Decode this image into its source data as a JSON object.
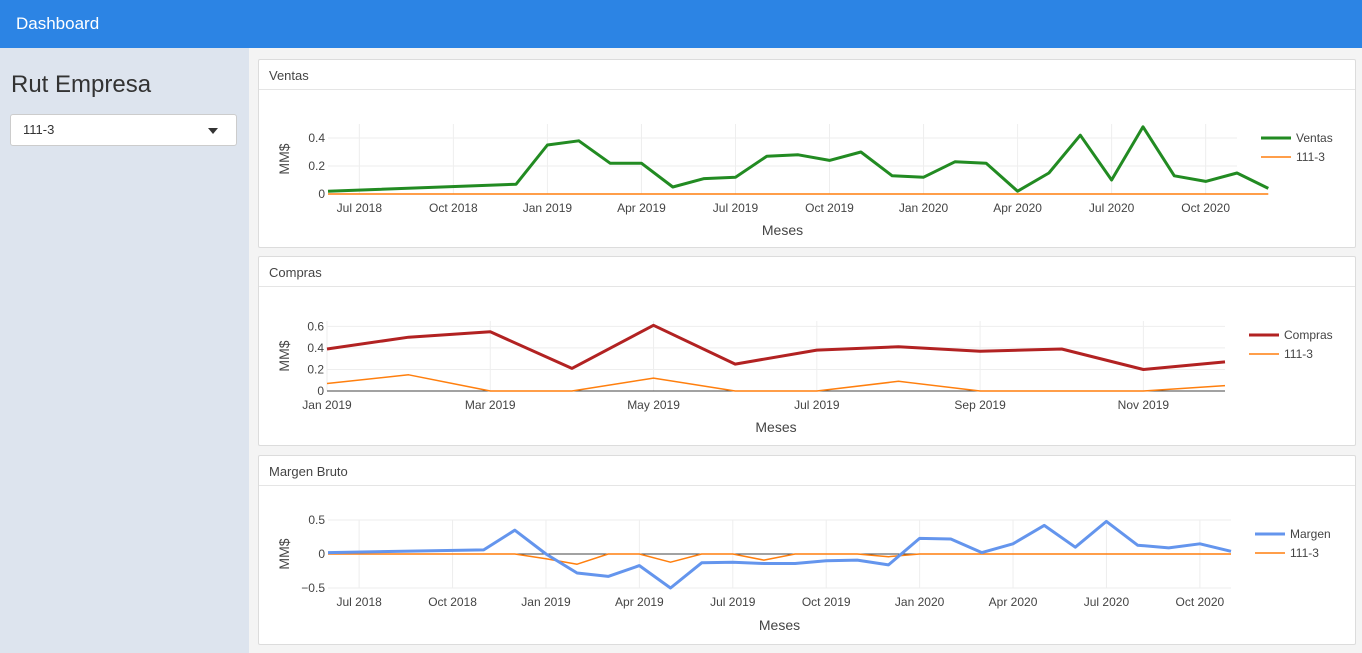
{
  "header": {
    "title": "Dashboard"
  },
  "sidebar": {
    "heading": "Rut Empresa",
    "select": {
      "value": "111-3"
    }
  },
  "colors": {
    "navbar": "#2c84e4",
    "ventas": "#228b22",
    "compras": "#b22222",
    "margen": "#6495ed",
    "company": "#ff7f0e"
  },
  "chart_data": [
    {
      "type": "line",
      "panel_title": "Ventas",
      "xlabel": "Meses",
      "ylabel": "MM$",
      "x_ticks": [
        "Jul 2018",
        "Oct 2018",
        "Jan 2019",
        "Apr 2019",
        "Jul 2019",
        "Oct 2019",
        "Jan 2020",
        "Apr 2020",
        "Jul 2020",
        "Oct 2020"
      ],
      "y_ticks": [
        "0",
        "0.2",
        "0.4"
      ],
      "xlim": [
        "2018-06",
        "2020-11"
      ],
      "ylim": [
        0,
        0.5
      ],
      "x": [
        "2018-06",
        "2018-12",
        "2019-01",
        "2019-02",
        "2019-03",
        "2019-04",
        "2019-05",
        "2019-06",
        "2019-07",
        "2019-08",
        "2019-09",
        "2019-10",
        "2019-11",
        "2019-12",
        "2020-01",
        "2020-02",
        "2020-03",
        "2020-04",
        "2020-05",
        "2020-06",
        "2020-07",
        "2020-08",
        "2020-09",
        "2020-10",
        "2020-11"
      ],
      "legend_placement": "right",
      "series": [
        {
          "name": "Ventas",
          "color": "#228b22",
          "width": 3,
          "values": [
            0.02,
            0.07,
            0.35,
            0.38,
            0.22,
            0.22,
            0.05,
            0.11,
            0.12,
            0.27,
            0.28,
            0.24,
            0.3,
            0.13,
            0.12,
            0.23,
            0.22,
            0.02,
            0.15,
            0.42,
            0.1,
            0.48,
            0.13,
            0.09,
            0.15,
            0.04
          ]
        },
        {
          "name": "111-3",
          "color": "#ff7f0e",
          "width": 1.5,
          "values": [
            0,
            0,
            0,
            0,
            0,
            0,
            0,
            0,
            0,
            0,
            0,
            0,
            0,
            0,
            0,
            0,
            0,
            0,
            0,
            0,
            0,
            0,
            0,
            0,
            0,
            0
          ]
        }
      ]
    },
    {
      "type": "line",
      "panel_title": "Compras",
      "xlabel": "Meses",
      "ylabel": "MM$",
      "x_ticks": [
        "Jan 2019",
        "Mar 2019",
        "May 2019",
        "Jul 2019",
        "Sep 2019",
        "Nov 2019"
      ],
      "y_ticks": [
        "0",
        "0.2",
        "0.4",
        "0.6"
      ],
      "xlim": [
        "2019-01",
        "2019-12"
      ],
      "ylim": [
        0,
        0.65
      ],
      "x": [
        "2019-01",
        "2019-02",
        "2019-03",
        "2019-04",
        "2019-05",
        "2019-06",
        "2019-07",
        "2019-08",
        "2019-09",
        "2019-10",
        "2019-11",
        "2019-12"
      ],
      "legend_placement": "right",
      "series": [
        {
          "name": "Compras",
          "color": "#b22222",
          "width": 3,
          "values": [
            0.39,
            0.5,
            0.55,
            0.21,
            0.61,
            0.25,
            0.38,
            0.41,
            0.37,
            0.39,
            0.2,
            0.27
          ]
        },
        {
          "name": "111-3",
          "color": "#ff7f0e",
          "width": 1.5,
          "values": [
            0.07,
            0.15,
            0.0,
            0.0,
            0.12,
            0.0,
            0.0,
            0.09,
            0.0,
            0.0,
            0.0,
            0.05
          ]
        }
      ]
    },
    {
      "type": "line",
      "panel_title": "Margen Bruto",
      "xlabel": "Meses",
      "ylabel": "MM$",
      "x_ticks": [
        "Jul 2018",
        "Oct 2018",
        "Jan 2019",
        "Apr 2019",
        "Jul 2019",
        "Oct 2019",
        "Jan 2020",
        "Apr 2020",
        "Jul 2020",
        "Oct 2020"
      ],
      "y_ticks": [
        "−0.5",
        "0",
        "0.5"
      ],
      "xlim": [
        "2018-06",
        "2020-11"
      ],
      "ylim": [
        -0.5,
        0.5
      ],
      "x": [
        "2018-06",
        "2018-11",
        "2018-12",
        "2019-01",
        "2019-02",
        "2019-03",
        "2019-04",
        "2019-05",
        "2019-06",
        "2019-07",
        "2019-08",
        "2019-09",
        "2019-10",
        "2019-11",
        "2019-12",
        "2020-01",
        "2020-02",
        "2020-03",
        "2020-04",
        "2020-05",
        "2020-06",
        "2020-07",
        "2020-08",
        "2020-09",
        "2020-10",
        "2020-11"
      ],
      "legend_placement": "right",
      "series": [
        {
          "name": "Margen",
          "color": "#6495ed",
          "width": 3,
          "values": [
            0.02,
            0.06,
            0.35,
            0.0,
            -0.28,
            -0.33,
            -0.17,
            -0.5,
            -0.13,
            -0.12,
            -0.14,
            -0.14,
            -0.1,
            -0.09,
            -0.16,
            0.23,
            0.22,
            0.02,
            0.15,
            0.42,
            0.1,
            0.48,
            0.13,
            0.09,
            0.15,
            0.04
          ]
        },
        {
          "name": "111-3",
          "color": "#ff7f0e",
          "width": 1.5,
          "values": [
            0,
            0,
            0,
            -0.07,
            -0.15,
            0,
            0,
            -0.12,
            0,
            0,
            -0.09,
            0,
            0,
            0,
            -0.04,
            0,
            0,
            0,
            0,
            0,
            0,
            0,
            0,
            0,
            0,
            0
          ]
        }
      ]
    }
  ]
}
